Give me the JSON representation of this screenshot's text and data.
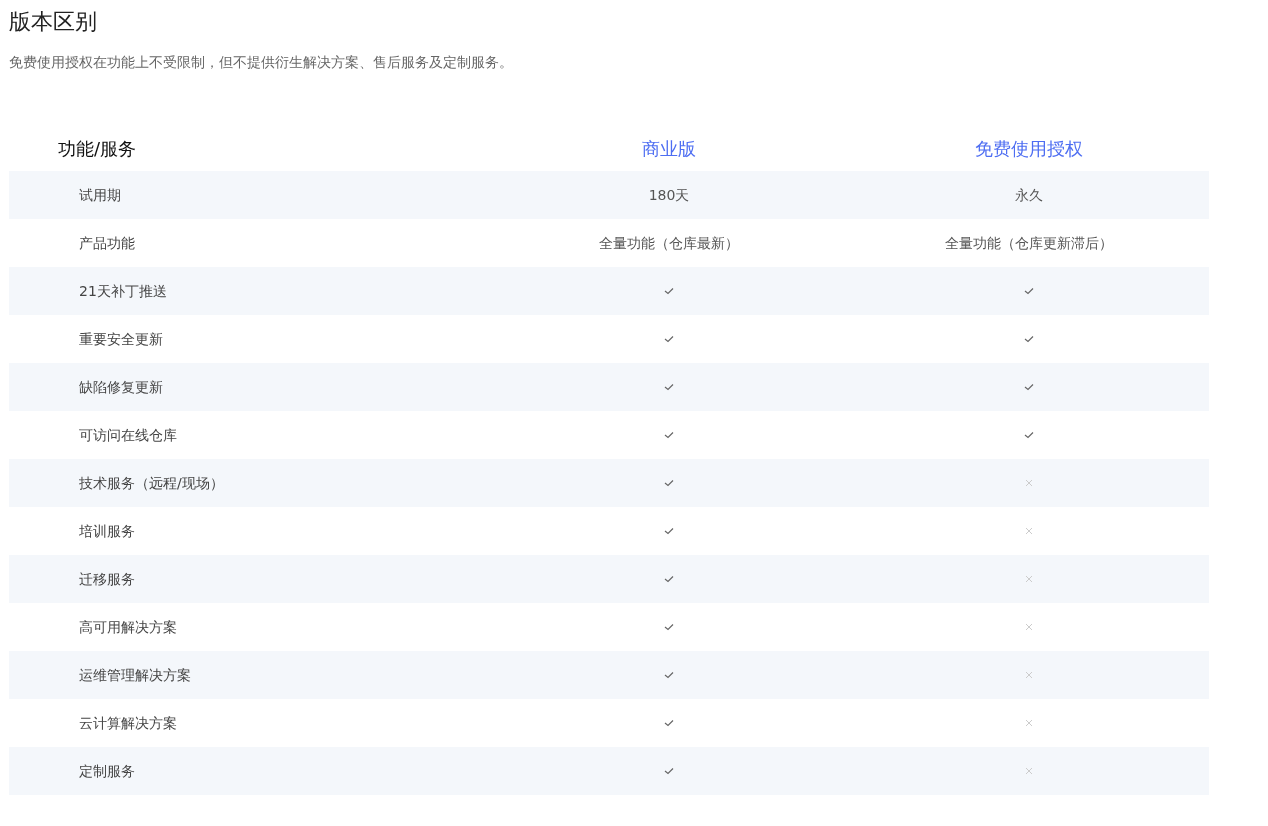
{
  "title": "版本区别",
  "subtitle": "免费使用授权在功能上不受限制，但不提供衍生解决方案、售后服务及定制服务。",
  "table": {
    "columns": [
      "功能/服务",
      "商业版",
      "免费使用授权"
    ],
    "rows": [
      {
        "cells": [
          {
            "kind": "label",
            "text": "试用期"
          },
          {
            "kind": "text",
            "text": "180天"
          },
          {
            "kind": "text",
            "text": "永久"
          }
        ]
      },
      {
        "cells": [
          {
            "kind": "label",
            "text": "产品功能"
          },
          {
            "kind": "text",
            "text": "全量功能（仓库最新）"
          },
          {
            "kind": "text",
            "text": "全量功能（仓库更新滞后）"
          }
        ]
      },
      {
        "cells": [
          {
            "kind": "label",
            "text": "21天补丁推送"
          },
          {
            "kind": "check",
            "included": true
          },
          {
            "kind": "check",
            "included": true
          }
        ]
      },
      {
        "cells": [
          {
            "kind": "label",
            "text": "重要安全更新"
          },
          {
            "kind": "check",
            "included": true
          },
          {
            "kind": "check",
            "included": true
          }
        ]
      },
      {
        "cells": [
          {
            "kind": "label",
            "text": "缺陷修复更新"
          },
          {
            "kind": "check",
            "included": true
          },
          {
            "kind": "check",
            "included": true
          }
        ]
      },
      {
        "cells": [
          {
            "kind": "label",
            "text": "可访问在线仓库"
          },
          {
            "kind": "check",
            "included": true
          },
          {
            "kind": "check",
            "included": true
          }
        ]
      },
      {
        "cells": [
          {
            "kind": "label",
            "text": "技术服务（远程/现场）"
          },
          {
            "kind": "check",
            "included": true
          },
          {
            "kind": "check",
            "included": false
          }
        ]
      },
      {
        "cells": [
          {
            "kind": "label",
            "text": "培训服务"
          },
          {
            "kind": "check",
            "included": true
          },
          {
            "kind": "check",
            "included": false
          }
        ]
      },
      {
        "cells": [
          {
            "kind": "label",
            "text": "迁移服务"
          },
          {
            "kind": "check",
            "included": true
          },
          {
            "kind": "check",
            "included": false
          }
        ]
      },
      {
        "cells": [
          {
            "kind": "label",
            "text": "高可用解决方案"
          },
          {
            "kind": "check",
            "included": true
          },
          {
            "kind": "check",
            "included": false
          }
        ]
      },
      {
        "cells": [
          {
            "kind": "label",
            "text": "运维管理解决方案"
          },
          {
            "kind": "check",
            "included": true
          },
          {
            "kind": "check",
            "included": false
          }
        ]
      },
      {
        "cells": [
          {
            "kind": "label",
            "text": "云计算解决方案"
          },
          {
            "kind": "check",
            "included": true
          },
          {
            "kind": "check",
            "included": false
          }
        ]
      },
      {
        "cells": [
          {
            "kind": "label",
            "text": "定制服务"
          },
          {
            "kind": "check",
            "included": true
          },
          {
            "kind": "check",
            "included": false
          }
        ]
      }
    ]
  }
}
